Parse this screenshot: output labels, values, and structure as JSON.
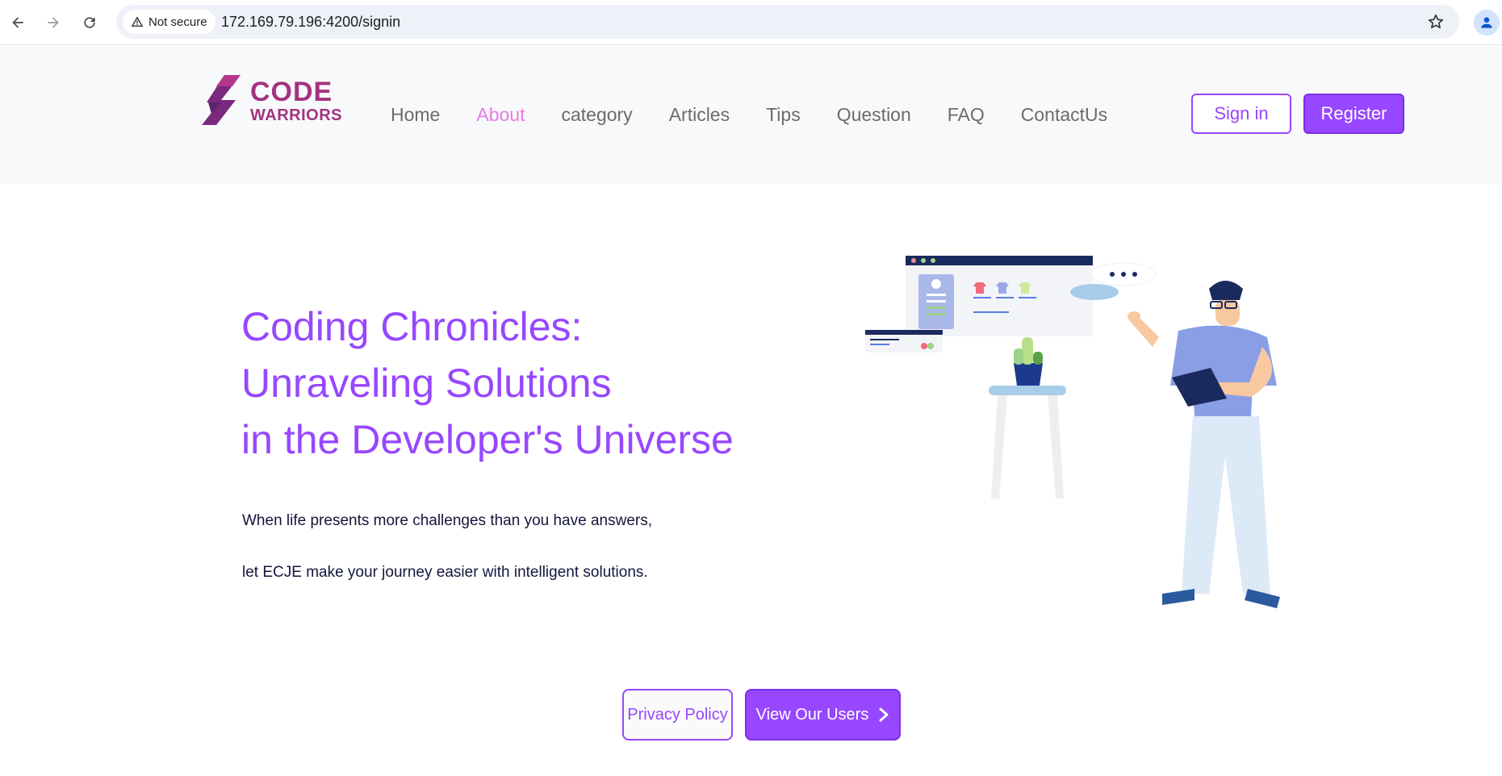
{
  "browser": {
    "security_label": "Not secure",
    "url": "172.169.79.196:4200/signin",
    "icons": [
      "back-icon",
      "forward-icon",
      "reload-icon",
      "warning-icon",
      "star-icon",
      "profile-icon"
    ]
  },
  "header": {
    "logo": {
      "line1": "CODE",
      "line2": "WARRIORS"
    },
    "nav": [
      {
        "label": "Home",
        "active": false
      },
      {
        "label": "About",
        "active": true
      },
      {
        "label": "category",
        "active": false
      },
      {
        "label": "Articles",
        "active": false
      },
      {
        "label": "Tips",
        "active": false
      },
      {
        "label": "Question",
        "active": false
      },
      {
        "label": "FAQ",
        "active": false
      },
      {
        "label": "ContactUs",
        "active": false
      }
    ],
    "signin_label": "Sign in",
    "register_label": "Register"
  },
  "hero": {
    "title_line1": "Coding Chronicles:",
    "title_line2": "Unraveling Solutions",
    "title_line3": "in the Developer's Universe",
    "subtitle_line1": "When life presents more challenges than you have answers,",
    "subtitle_line2": "let ECJE make your journey easier with intelligent solutions."
  },
  "footer_actions": {
    "privacy_label": "Privacy Policy",
    "users_label": "View Our Users"
  },
  "colors": {
    "accent": "#9747ff",
    "active_nav": "#e87ae3",
    "logo": "#a3337f",
    "text_dark": "#14163e"
  }
}
